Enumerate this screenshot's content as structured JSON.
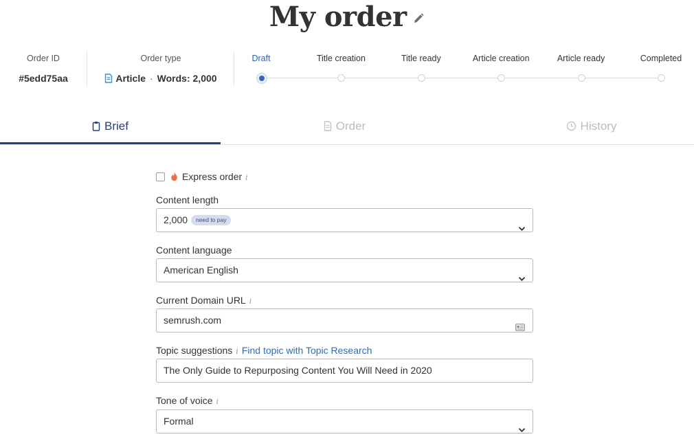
{
  "header": {
    "title": "My order"
  },
  "order": {
    "id_label": "Order ID",
    "id_value": "#5edd75aa",
    "type_label": "Order type",
    "type_value": "Article",
    "separator": "·",
    "words_value": "Words: 2,000"
  },
  "steps": [
    {
      "label": "Draft",
      "active": true
    },
    {
      "label": "Title creation",
      "active": false
    },
    {
      "label": "Title ready",
      "active": false
    },
    {
      "label": "Article creation",
      "active": false
    },
    {
      "label": "Article ready",
      "active": false
    },
    {
      "label": "Completed",
      "active": false
    }
  ],
  "tabs": [
    {
      "label": "Brief",
      "icon": "clipboard-icon",
      "active": true
    },
    {
      "label": "Order",
      "icon": "document-icon",
      "active": false
    },
    {
      "label": "History",
      "icon": "clock-icon",
      "active": false
    }
  ],
  "form": {
    "express_label": "Express order",
    "express_checked": false,
    "info_glyph": "i",
    "content_length_label": "Content length",
    "content_length_value": "2,000",
    "content_length_badge": "need to pay",
    "content_language_label": "Content language",
    "content_language_value": "American English",
    "domain_label": "Current Domain URL",
    "domain_value": "semrush.com",
    "topic_label": "Topic suggestions",
    "topic_link": "Find topic with Topic Research",
    "topic_value": "The Only Guide to Repurposing Content You Will Need in 2020",
    "tone_label": "Tone of voice",
    "tone_value": "Formal"
  },
  "colors": {
    "accent": "#3d63b5",
    "tab_active": "#2b3f73",
    "link": "#2f6bb7",
    "badge_bg": "#d5dcee",
    "flame": "#e8734a"
  }
}
